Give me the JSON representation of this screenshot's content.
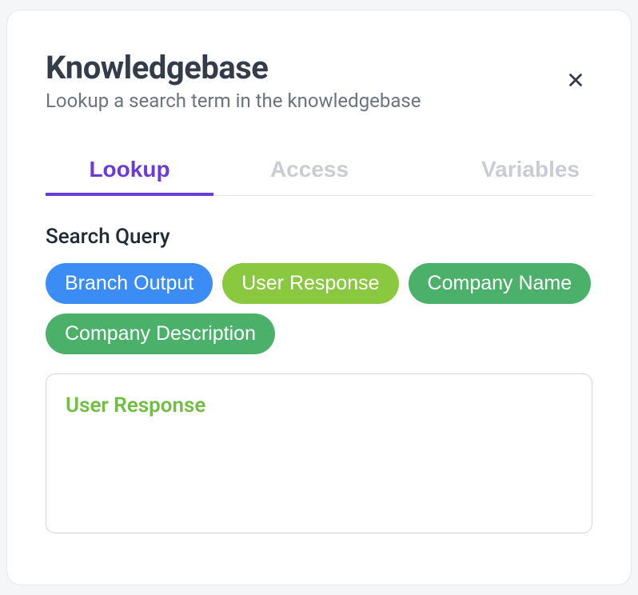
{
  "header": {
    "title": "Knowledgebase",
    "subtitle": "Lookup a search term in the knowledgebase"
  },
  "tabs": {
    "lookup": "Lookup",
    "access": "Access",
    "variables": "Variables"
  },
  "section": {
    "search_query_label": "Search Query"
  },
  "chips": {
    "branch_output": "Branch Output",
    "user_response": "User Response",
    "company_name": "Company Name",
    "company_description": "Company Description"
  },
  "query_box": {
    "value": "User Response"
  }
}
